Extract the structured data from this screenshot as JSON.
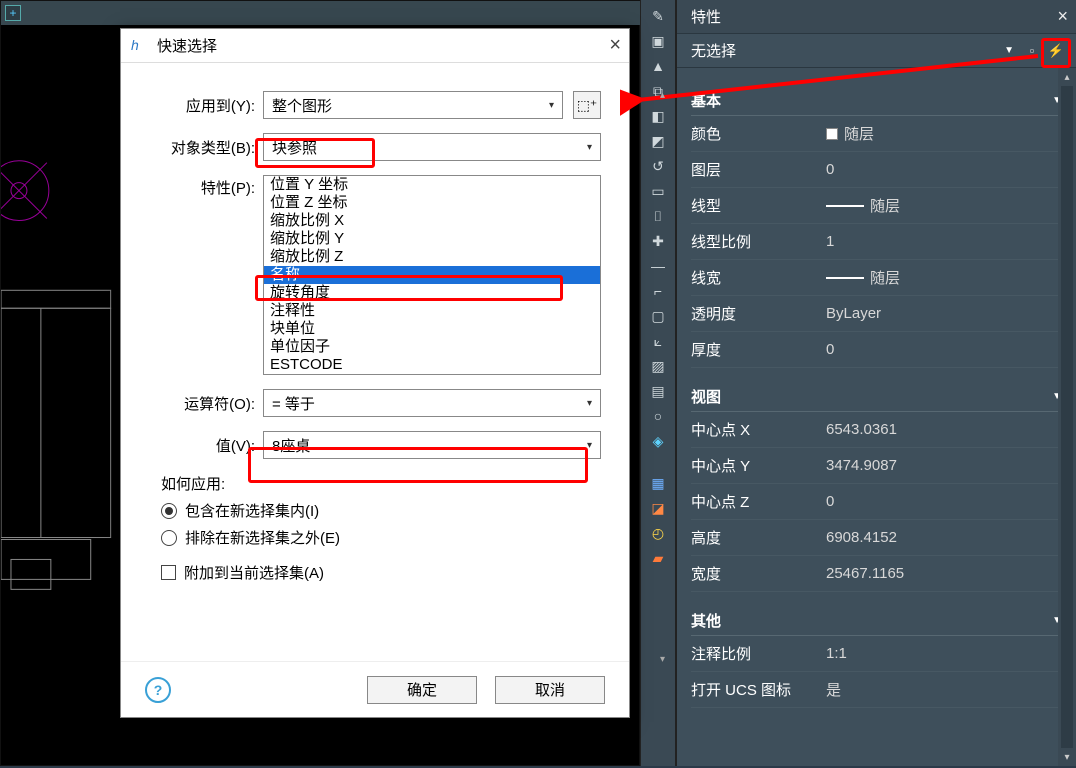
{
  "dialog": {
    "title": "快速选择",
    "apply_label": "应用到(Y):",
    "apply_value": "整个图形",
    "objtype_label": "对象类型(B):",
    "objtype_value": "块参照",
    "properties_label": "特性(P):",
    "properties_items": {
      "i0": "位置 Y 坐标",
      "i1": "位置 Z 坐标",
      "i2": "缩放比例 X",
      "i3": "缩放比例 Y",
      "i4": "缩放比例 Z",
      "i5": "名称",
      "i6": "旋转角度",
      "i7": "注释性",
      "i8": "块单位",
      "i9": "单位因子",
      "i10": "ESTCODE"
    },
    "operator_label": "运算符(O):",
    "operator_value": "= 等于",
    "value_label": "值(V):",
    "value_value": "8座桌",
    "howto_label": "如何应用:",
    "radio_include": "包含在新选择集内(I)",
    "radio_exclude": "排除在新选择集之外(E)",
    "append_checkbox": "附加到当前选择集(A)",
    "ok": "确定",
    "cancel": "取消"
  },
  "props": {
    "panel_title": "特性",
    "no_selection": "无选择",
    "sect_basic": "基本",
    "sect_view": "视图",
    "sect_other": "其他",
    "rows": {
      "color_l": "颜色",
      "color_v": "随层",
      "layer_l": "图层",
      "layer_v": "0",
      "ltype_l": "线型",
      "ltype_v": "随层",
      "ltscale_l": "线型比例",
      "ltscale_v": "1",
      "lweight_l": "线宽",
      "lweight_v": "随层",
      "transp_l": "透明度",
      "transp_v": "ByLayer",
      "thick_l": "厚度",
      "thick_v": "0",
      "cx_l": "中心点 X",
      "cx_v": "6543.0361",
      "cy_l": "中心点 Y",
      "cy_v": "3474.9087",
      "cz_l": "中心点 Z",
      "cz_v": "0",
      "height_l": "高度",
      "height_v": "6908.4152",
      "width_l": "宽度",
      "width_v": "25467.1165",
      "anno_l": "注释比例",
      "anno_v": "1:1",
      "ucs_l": "打开 UCS 图标",
      "ucs_v": "是"
    }
  }
}
